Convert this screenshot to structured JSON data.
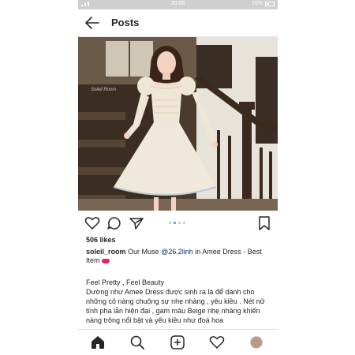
{
  "status_bar": {
    "time": "20:06",
    "battery": "16%"
  },
  "header": {
    "title": "Posts"
  },
  "post": {
    "image_watermark": "Soleil Room",
    "carousel": {
      "count": 4,
      "active_index": 1
    },
    "likes": "506 likes",
    "caption": {
      "username": "soleil_room",
      "text_before": "Our Muse",
      "mention": "@26.2linh",
      "text_after": "in Amee Dress - Best Item"
    },
    "body": {
      "line1": "Feel Pretty , Feel Beauty",
      "paragraph": "Dường như Amee Dress được sinh ra là để dành cho những cô nàng chuộng sự nhẹ nhàng , yêu kiều . Nét nữ tính pha lẫn hiện đại , gam màu Beige nhẹ nhàng khiến nàng trông nổi bật và yêu kiều như đoá hoa"
    }
  },
  "icons": {
    "back": "back-arrow-icon",
    "like": "heart-icon",
    "comment": "comment-icon",
    "share": "send-icon",
    "save": "bookmark-icon",
    "nav": [
      "home-icon",
      "search-icon",
      "add-post-icon",
      "activity-heart-icon",
      "profile-avatar"
    ]
  },
  "colors": {
    "mention": "#003569",
    "carousel_active": "#3897f0",
    "dress": "#efe6d6"
  }
}
